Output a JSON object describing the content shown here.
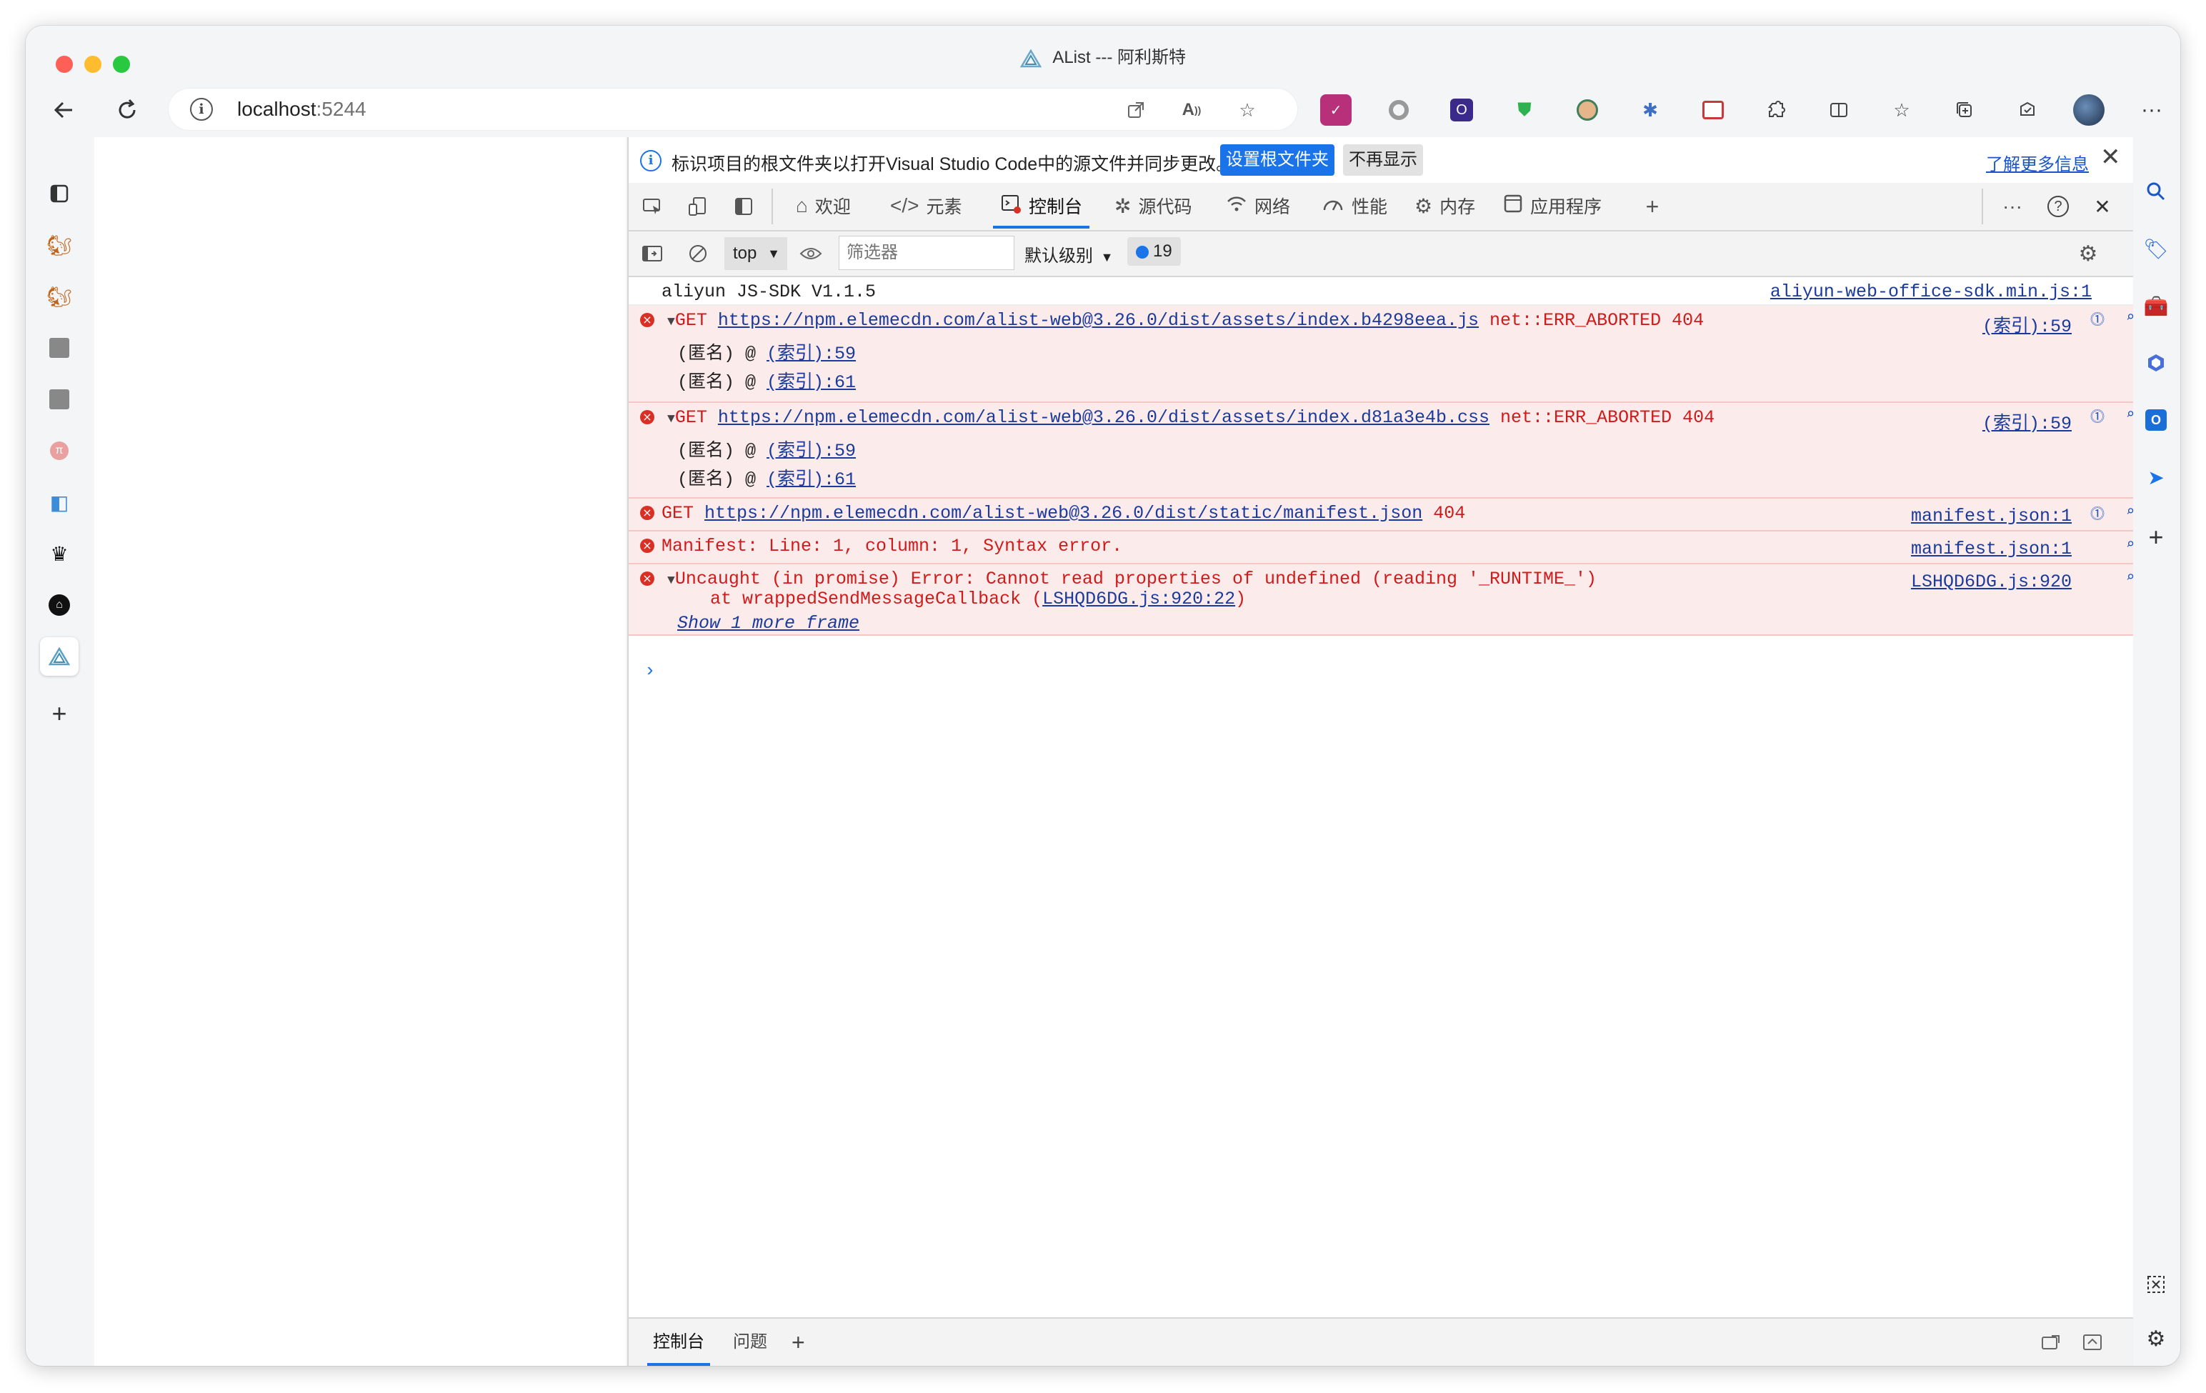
{
  "window": {
    "title": "AList --- 阿利斯特"
  },
  "omnibox": {
    "host": "localhost",
    "port": ":5244"
  },
  "toolbar": {
    "more_label": "···"
  },
  "devtools": {
    "infobar": {
      "text": "标识项目的根文件夹以打开Visual Studio Code中的源文件并同步更改。",
      "primary_button": "设置根文件夹",
      "secondary_button": "不再显示",
      "learn_more": "了解更多信息"
    },
    "tabs": [
      {
        "label": "欢迎",
        "icon": "home-icon"
      },
      {
        "label": "元素",
        "icon": "code-icon"
      },
      {
        "label": "控制台",
        "icon": "console-icon",
        "active": true
      },
      {
        "label": "源代码",
        "icon": "bug-icon"
      },
      {
        "label": "网络",
        "icon": "wifi-icon"
      },
      {
        "label": "性能",
        "icon": "gauge-icon"
      },
      {
        "label": "内存",
        "icon": "memory-icon"
      },
      {
        "label": "应用程序",
        "icon": "app-icon"
      }
    ],
    "filterbar": {
      "context": "top",
      "filter_placeholder": "筛选器",
      "level": "默认级别",
      "issues_count": "19"
    },
    "console": {
      "messages": [
        {
          "type": "log",
          "text": "aliyun JS-SDK V1.1.5",
          "source": "aliyun-web-office-sdk.min.js:1"
        },
        {
          "type": "error",
          "method": "GET",
          "url": "https://npm.elemecdn.com/alist-web@3.26.0/dist/assets/index.b4298eea.js",
          "suffix": "net::ERR_ABORTED 404",
          "source": "(索引):59",
          "stack": [
            {
              "prefix": "(匿名) @ ",
              "link": "(索引):59"
            },
            {
              "prefix": "(匿名) @ ",
              "link": "(索引):61"
            }
          ]
        },
        {
          "type": "error",
          "method": "GET",
          "url": "https://npm.elemecdn.com/alist-web@3.26.0/dist/assets/index.d81a3e4b.css",
          "suffix": "net::ERR_ABORTED 404",
          "source": "(索引):59",
          "stack": [
            {
              "prefix": "(匿名) @ ",
              "link": "(索引):59"
            },
            {
              "prefix": "(匿名) @ ",
              "link": "(索引):61"
            }
          ]
        },
        {
          "type": "error",
          "method": "GET",
          "url": "https://npm.elemecdn.com/alist-web@3.26.0/dist/static/manifest.json",
          "suffix": "404",
          "source": "manifest.json:1"
        },
        {
          "type": "error",
          "text": "Manifest: Line: 1, column: 1, Syntax error.",
          "source": "manifest.json:1"
        },
        {
          "type": "error",
          "text": "Uncaught (in promise) Error: Cannot read properties of undefined (reading '_RUNTIME_')",
          "at_prefix": "    at wrappedSendMessageCallback (",
          "at_link": "LSHQD6DG.js:920:22",
          "at_suffix": ")",
          "show_more": "Show 1 more frame",
          "source": "LSHQD6DG.js:920"
        }
      ]
    },
    "drawer": {
      "tabs": [
        "控制台",
        "问题"
      ]
    }
  },
  "colors": {
    "accent": "#1a73e8",
    "error_bg": "#fcebeb",
    "error_text": "#d11a1a"
  }
}
